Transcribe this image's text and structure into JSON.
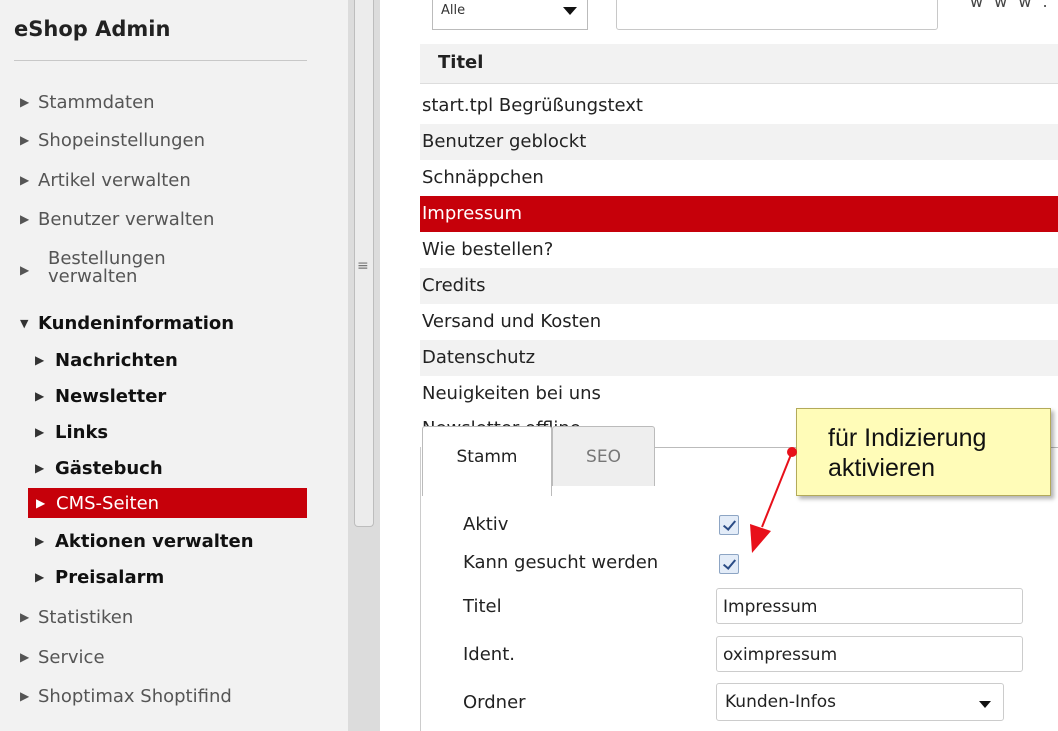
{
  "sidebar": {
    "title": "eShop Admin",
    "menu": [
      {
        "label": "Stammdaten",
        "arrow": "▶"
      },
      {
        "label": "Shopeinstellungen",
        "arrow": "▶"
      },
      {
        "label": "Artikel verwalten",
        "arrow": "▶"
      },
      {
        "label": "Benutzer verwalten",
        "arrow": "▶"
      }
    ],
    "bestellungen": {
      "line1": "Bestellungen",
      "line2": "verwalten",
      "arrow": "▶"
    },
    "open_section": {
      "label": "Kundeninformation",
      "arrow": "▼"
    },
    "sub_items": [
      {
        "label": "Nachrichten",
        "arrow": "▶"
      },
      {
        "label": "Newsletter",
        "arrow": "▶"
      },
      {
        "label": "Links",
        "arrow": "▶"
      },
      {
        "label": "Gästebuch",
        "arrow": "▶"
      },
      {
        "label": "CMS-Seiten",
        "arrow": "▶",
        "active": true
      },
      {
        "label": "Aktionen verwalten",
        "arrow": "▶"
      },
      {
        "label": "Preisalarm",
        "arrow": "▶"
      }
    ],
    "menu_bottom": [
      {
        "label": "Statistiken",
        "arrow": "▶"
      },
      {
        "label": "Service",
        "arrow": "▶"
      },
      {
        "label": "Shoptimax Shoptifind",
        "arrow": "▶"
      }
    ]
  },
  "divider": {
    "grip": "≡"
  },
  "filter": {
    "select_value": "Alle",
    "corner_text": "w w w ."
  },
  "list": {
    "header": "Titel",
    "rows": [
      "start.tpl Begrüßungstext",
      "Benutzer geblockt",
      "Schnäppchen",
      "Impressum",
      "Wie bestellen?",
      "Credits",
      "Versand und Kosten",
      "Datenschutz",
      "Neuigkeiten bei uns",
      "Newsletter-offline"
    ],
    "selected_index": 3
  },
  "detail": {
    "tabs": [
      "Stamm",
      "SEO"
    ],
    "active_tab": "Stamm",
    "fields": {
      "aktiv_label": "Aktiv",
      "aktiv_checked": true,
      "suche_label": "Kann gesucht werden",
      "suche_checked": true,
      "titel_label": "Titel",
      "titel_value": "Impressum",
      "ident_label": "Ident.",
      "ident_value": "oximpressum",
      "ordner_label": "Ordner",
      "ordner_value": "Kunden-Infos"
    }
  },
  "callout": {
    "line1": "für Indizierung",
    "line2": "aktivieren",
    "color": "#fffcb8",
    "arrow_color": "#e8101a"
  },
  "colors": {
    "accent": "#c6000a",
    "sidebar_bg": "#f2f2f2",
    "row_alt": "#f2f2f2"
  }
}
